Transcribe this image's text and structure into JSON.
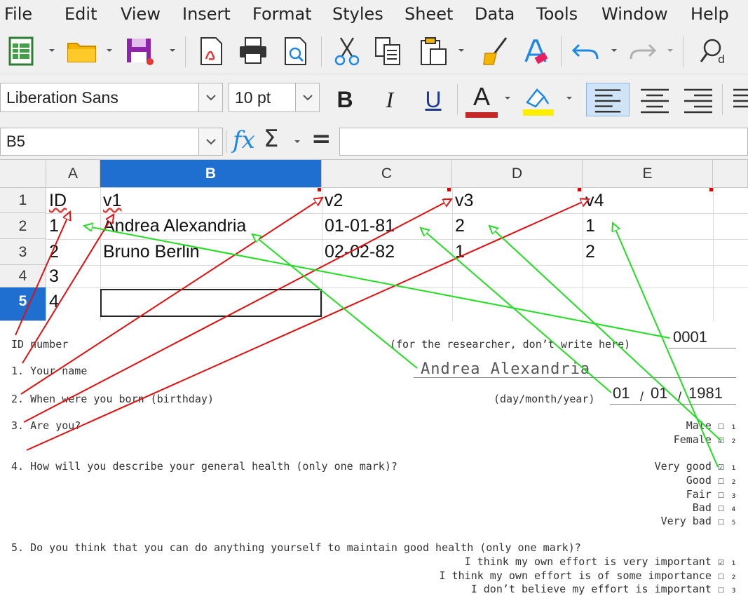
{
  "menu": [
    "File",
    "Edit",
    "View",
    "Insert",
    "Format",
    "Styles",
    "Sheet",
    "Data",
    "Tools",
    "Window",
    "Help"
  ],
  "format_bar": {
    "font_name": "Liberation Sans",
    "font_size": "10 pt",
    "bold_label": "B",
    "italic_label": "I",
    "underline_label": "U",
    "font_color_label": "A"
  },
  "formula_bar": {
    "cell_ref": "B5",
    "function_label": "fx",
    "sum_label": "Σ",
    "equals_label": "=",
    "formula_value": ""
  },
  "sheet": {
    "columns": [
      "A",
      "B",
      "C",
      "D",
      "E"
    ],
    "rows": [
      "1",
      "2",
      "3",
      "4",
      "5"
    ],
    "cells": [
      [
        "ID",
        "v1",
        "v2",
        "v3",
        "v4"
      ],
      [
        "1",
        "Andrea Alexandria",
        "01-01-81",
        "2",
        "1"
      ],
      [
        "2",
        "Bruno Berlin",
        "02-02-82",
        "1",
        "2"
      ],
      [
        "3",
        "",
        "",
        "",
        ""
      ],
      [
        "4",
        "",
        "",
        "",
        ""
      ]
    ]
  },
  "questionnaire": {
    "id_label": "ID number",
    "researcher_note": "(for the researcher, don’t write here)",
    "id_value": "0001",
    "q1": "1. Your name",
    "name_value": "Andrea Alexandria",
    "q2": "2. When were you born (birthday)",
    "date_hint": "(day/month/year)",
    "day": "01",
    "month": "01",
    "year": "1981",
    "q3": "3. Are you?",
    "sex_options": [
      "Male ☐ ₁",
      "Female ☑ ₂"
    ],
    "q4": "4. How will you describe your general health (only one mark)?",
    "health_options": [
      "Very good ☑ ₁",
      "Good ☐ ₂",
      "Fair ☐ ₃",
      "Bad ☐ ₄",
      "Very bad ☐ ₅"
    ],
    "q5": "5. Do you think that you can do anything yourself to maintain good health (only one mark)?",
    "effort_options": [
      "I think my own effort is very important ☑ ₁",
      "I think my own effort is of some importance ☐ ₂",
      "I don’t believe my effort is important ☐ ₃"
    ]
  },
  "colors": {
    "selection": "#1f6fd0",
    "arrow_red": "#e01010",
    "arrow_green": "#22dd22",
    "font_color_bar": "#c62828",
    "highlight_bar": "#ffee00"
  }
}
